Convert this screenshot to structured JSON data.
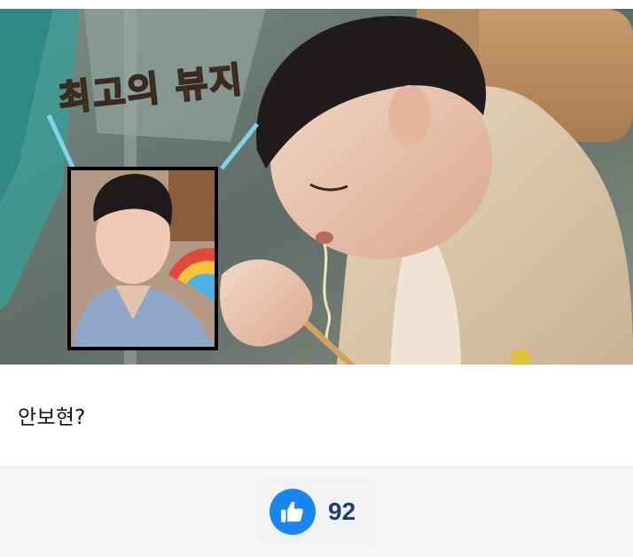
{
  "image": {
    "caption_overlay": "최고의 뷰지"
  },
  "post": {
    "text": "안보현?"
  },
  "reactions": {
    "like_icon": "thumbs-up-icon",
    "like_count": "92",
    "accent_color": "#1a86f2"
  }
}
